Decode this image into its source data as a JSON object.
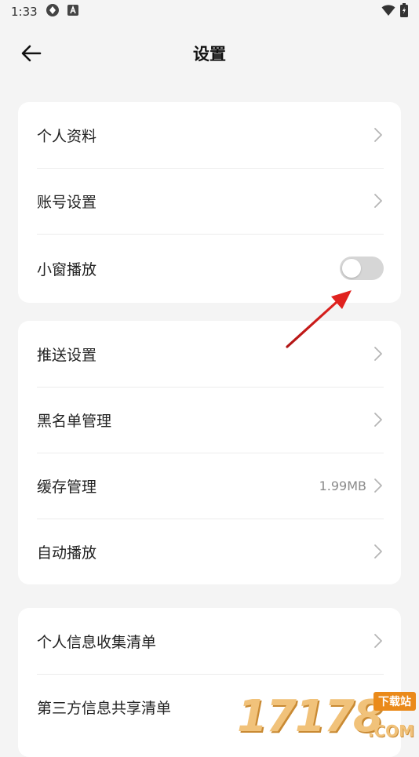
{
  "status_bar": {
    "time": "1:33"
  },
  "app_bar": {
    "title": "设置"
  },
  "cards": [
    {
      "rows": [
        {
          "label": "个人资料",
          "kind": "chevron"
        },
        {
          "label": "账号设置",
          "kind": "chevron"
        },
        {
          "label": "小窗播放",
          "kind": "toggle",
          "toggle_on": false
        }
      ]
    },
    {
      "rows": [
        {
          "label": "推送设置",
          "kind": "chevron"
        },
        {
          "label": "黑名单管理",
          "kind": "chevron"
        },
        {
          "label": "缓存管理",
          "kind": "chevron",
          "value": "1.99MB"
        },
        {
          "label": "自动播放",
          "kind": "chevron"
        }
      ]
    },
    {
      "rows": [
        {
          "label": "个人信息收集清单",
          "kind": "chevron"
        },
        {
          "label": "第三方信息共享清单",
          "kind": "chevron"
        }
      ]
    }
  ],
  "watermark": {
    "digits": "17178",
    "badge": "下载站",
    "suffix": ".COM"
  },
  "colors": {
    "annotation_arrow": "#e0221f",
    "toggle_off": "#d6d6d6"
  }
}
